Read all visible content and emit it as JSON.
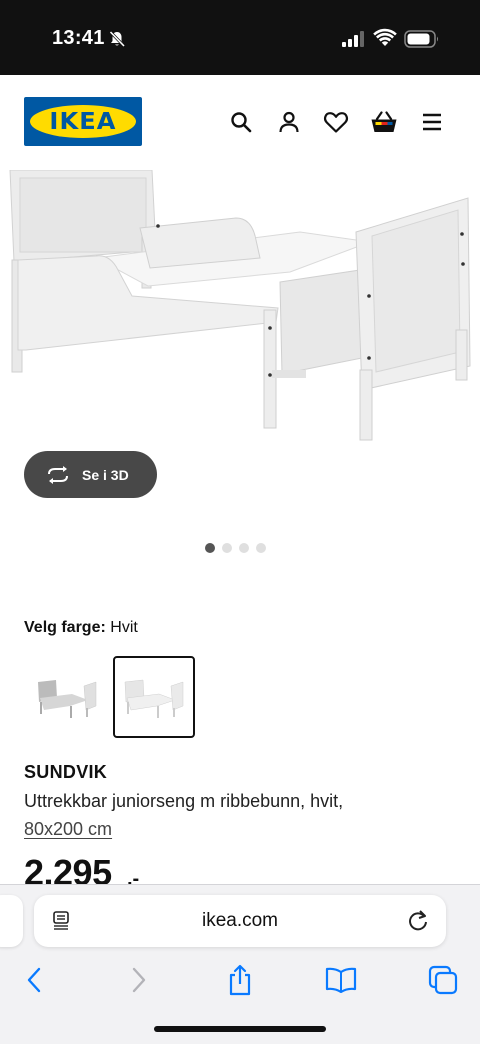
{
  "status_bar": {
    "time": "13:41"
  },
  "header": {
    "logo_text": "IKEA",
    "icons": [
      "search-icon",
      "user-icon",
      "heart-icon",
      "basket-icon",
      "menu-icon"
    ]
  },
  "gallery": {
    "button_3d_label": "Se i 3D",
    "dot_count": 4,
    "active_dot": 0
  },
  "color_select": {
    "label": "Velg farge:",
    "value": "Hvit",
    "swatches": [
      {
        "name": "grey-variant",
        "selected": false
      },
      {
        "name": "white-variant",
        "selected": true
      }
    ]
  },
  "product": {
    "name": "SUNDVIK",
    "description": "Uttrekkbar juniorseng m ribbebunn, hvit,",
    "size": "80x200 cm",
    "price": "2.295",
    "price_suffix": ",-"
  },
  "browser": {
    "url": "ikea.com",
    "accent": "#0a7aff"
  },
  "colors": {
    "ikea_blue": "#0058a3",
    "ikea_yellow": "#ffdb00",
    "button_3d_bg": "#484848"
  }
}
